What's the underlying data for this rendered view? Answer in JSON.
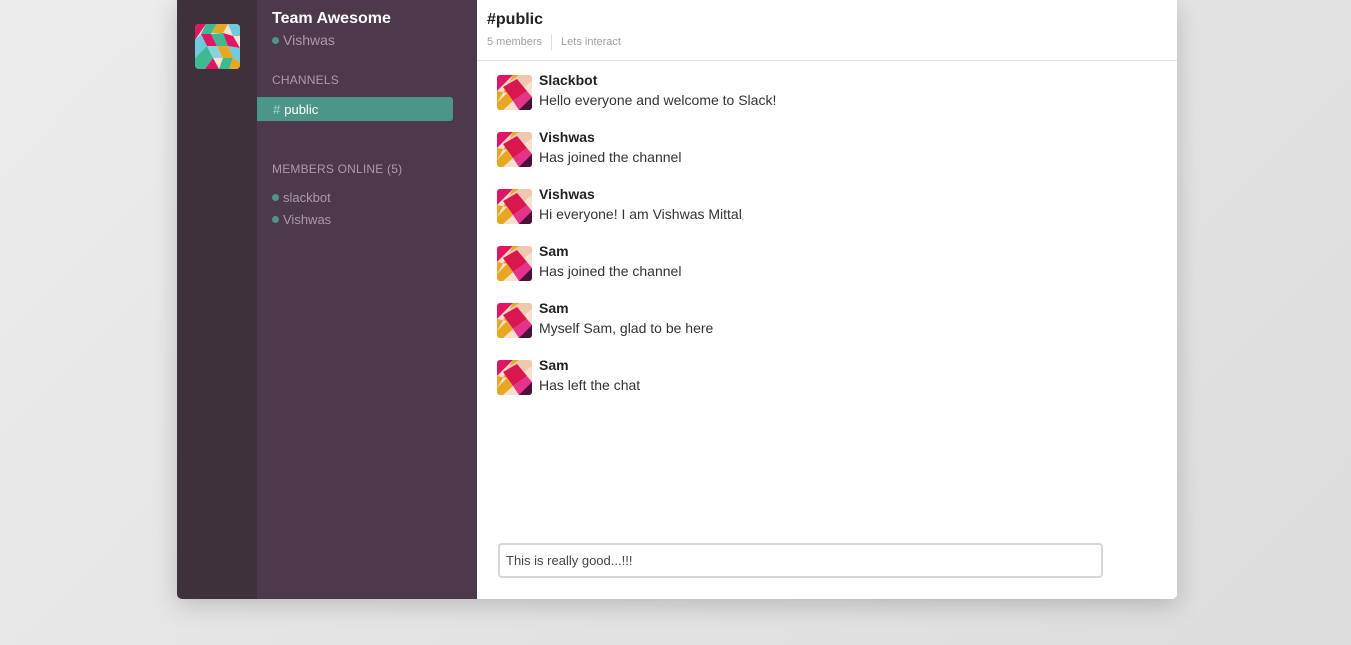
{
  "team": {
    "name": "Team Awesome",
    "current_user": "Vishwas"
  },
  "sidebar": {
    "channels_title": "CHANNELS",
    "channels": [
      {
        "hash": "#",
        "name": "public",
        "active": true
      }
    ],
    "members_title": "MEMBERS ONLINE (5)",
    "members": [
      {
        "name": "slackbot"
      },
      {
        "name": "Vishwas"
      }
    ]
  },
  "header": {
    "channel": "#public",
    "member_count": "5 members",
    "topic": "Lets interact"
  },
  "messages": [
    {
      "author": "Slackbot",
      "text": "Hello everyone and welcome to Slack!"
    },
    {
      "author": "Vishwas",
      "text": "Has joined the channel"
    },
    {
      "author": "Vishwas",
      "text": "Hi everyone! I am Vishwas Mittal"
    },
    {
      "author": "Sam",
      "text": "Has joined the channel"
    },
    {
      "author": "Sam",
      "text": "Myself Sam, glad to be here"
    },
    {
      "author": "Sam",
      "text": "Has left the chat"
    }
  ],
  "composer": {
    "value": "This is really good...!!!"
  },
  "colors": {
    "team_rail": "#3e313c",
    "sidebar": "#4d394b",
    "accent": "#4c9689",
    "sidebar_text": "#ab9ba9"
  },
  "icons": {
    "team_logo": "slack-logo-icon",
    "avatar": "user-avatar-icon",
    "presence": "presence-dot-icon"
  }
}
